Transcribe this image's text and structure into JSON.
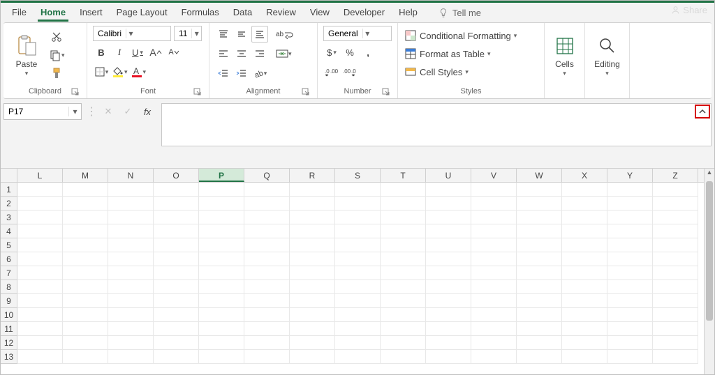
{
  "tabs": [
    "File",
    "Home",
    "Insert",
    "Page Layout",
    "Formulas",
    "Data",
    "Review",
    "View",
    "Developer",
    "Help"
  ],
  "active_tab": "Home",
  "tell_me": "Tell me",
  "share": "Share",
  "clipboard": {
    "paste": "Paste",
    "label": "Clipboard"
  },
  "font": {
    "name": "Calibri",
    "size": "11",
    "label": "Font"
  },
  "alignment": {
    "label": "Alignment",
    "wrap_hint": "ab"
  },
  "number": {
    "format": "General",
    "label": "Number",
    "currency": "$",
    "percent": "%",
    "comma": ","
  },
  "styles": {
    "conditional": "Conditional Formatting",
    "table": "Format as Table",
    "cell": "Cell Styles",
    "label": "Styles"
  },
  "cells": {
    "label": "Cells"
  },
  "editing": {
    "label": "Editing"
  },
  "namebox": "P17",
  "fx_symbol": "fx",
  "columns": [
    "L",
    "M",
    "N",
    "O",
    "P",
    "Q",
    "R",
    "S",
    "T",
    "U",
    "V",
    "W",
    "X",
    "Y",
    "Z"
  ],
  "selected_column": "P",
  "row_count": 13
}
